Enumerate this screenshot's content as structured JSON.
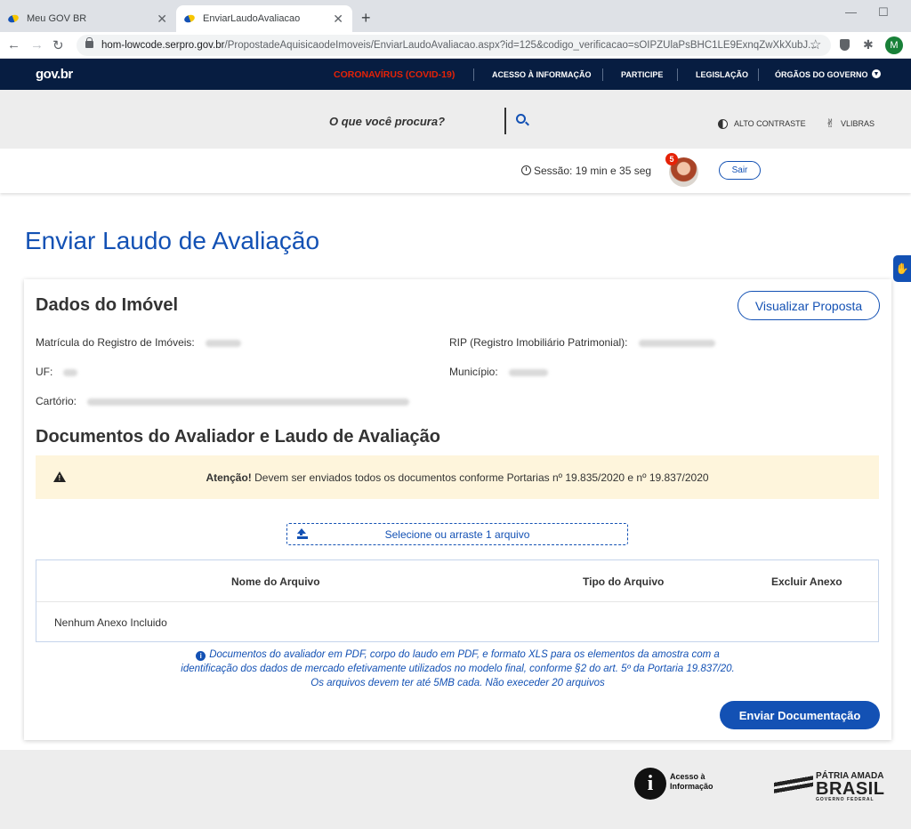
{
  "browser": {
    "tabs": [
      {
        "title": "Meu GOV BR",
        "active": false
      },
      {
        "title": "EnviarLaudoAvaliacao",
        "active": true
      }
    ],
    "url_host": "hom-lowcode.serpro.gov.br",
    "url_path": "/PropostadeAquisicaodeImoveis/EnviarLaudoAvaliacao.aspx?id=125&codigo_verificacao=sOIPZUlaPsBHC1LE9ExnqZwXkXubJ...",
    "profile_initial": "M"
  },
  "govnav": {
    "logo": "gov.br",
    "covid": "CORONAVÍRUS (COVID-19)",
    "links": [
      "ACESSO À INFORMAÇÃO",
      "PARTICIPE",
      "LEGISLAÇÃO",
      "ÓRGÃOS DO GOVERNO"
    ]
  },
  "search": {
    "prompt": "O que você procura?",
    "high_contrast": "ALTO CONTRASTE",
    "vlibras": "VLIBRAS"
  },
  "session": {
    "text": "Sessão: 19 min e 35 seg",
    "notifications": "5",
    "logout": "Sair"
  },
  "page": {
    "title": "Enviar Laudo de Avaliação"
  },
  "property": {
    "section_title": "Dados do Imóvel",
    "view_button": "Visualizar Proposta",
    "fields": {
      "matricula": "Matrícula do Registro de Imóveis:",
      "rip": "RIP (Registro Imobiliário Patrimonial):",
      "uf": "UF:",
      "municipio": "Município:",
      "cartorio": "Cartório:"
    }
  },
  "documents": {
    "section_title": "Documentos do Avaliador e Laudo de Avaliação",
    "alert_bold": "Atenção!",
    "alert_text": " Devem ser enviados todos os documentos conforme Portarias nº 19.835/2020 e nº 19.837/2020",
    "upload_label": "Selecione ou arraste 1 arquivo",
    "table_headers": [
      "Nome do Arquivo",
      "Tipo do Arquivo",
      "Excluir Anexo"
    ],
    "empty_text": "Nenhum Anexo Incluido",
    "info_line1": "Documentos do avaliador em PDF, corpo do laudo em PDF, e formato XLS para os elementos da amostra com a",
    "info_line2": "identificação dos dados de mercado efetivamente utilizados no modelo final, conforme §2 do art. 5º da Portaria 19.837/20.",
    "info_line3": "Os arquivos devem ter até  5MB cada. Não execeder 20 arquivos",
    "submit": "Enviar Documentação"
  },
  "footer": {
    "acesso_line1": "Acesso à",
    "acesso_line2": "Informação",
    "brasil_line1": "PÁTRIA AMADA",
    "brasil_line2": "BRASIL",
    "brasil_line3": "GOVERNO FEDERAL"
  }
}
